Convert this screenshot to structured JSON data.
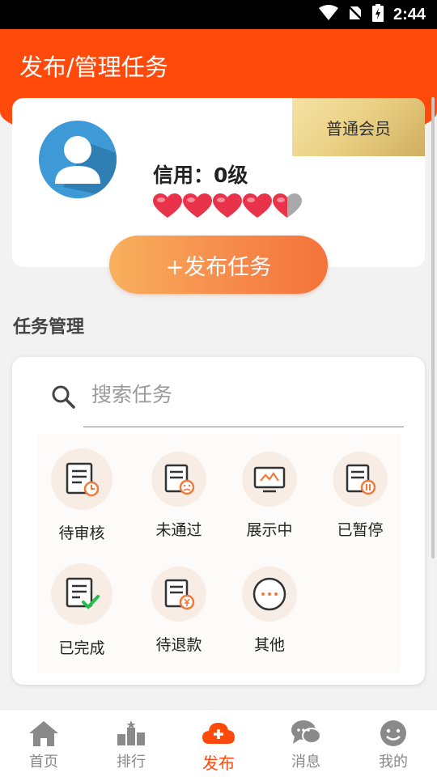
{
  "status_bar": {
    "time": "2:44"
  },
  "header": {
    "title": "发布/管理任务"
  },
  "profile": {
    "member_level": "普通会员",
    "credit_text": "信用：0级",
    "hearts_full": 4,
    "hearts_total": 5
  },
  "publish_button": {
    "label": "+发布任务"
  },
  "task_management": {
    "title": "任务管理",
    "search": {
      "placeholder": "搜索任务"
    },
    "items": [
      {
        "label": "待审核",
        "icon": "pending-review-icon"
      },
      {
        "label": "未通过",
        "icon": "rejected-icon"
      },
      {
        "label": "展示中",
        "icon": "displaying-icon"
      },
      {
        "label": "已暂停",
        "icon": "paused-icon"
      },
      {
        "label": "已完成",
        "icon": "completed-icon"
      },
      {
        "label": "待退款",
        "icon": "pending-refund-icon"
      },
      {
        "label": "其他",
        "icon": "more-icon"
      }
    ]
  },
  "bottom_nav": {
    "items": [
      {
        "label": "首页",
        "icon": "home-icon"
      },
      {
        "label": "排行",
        "icon": "ranking-icon"
      },
      {
        "label": "发布",
        "icon": "publish-icon",
        "active": true
      },
      {
        "label": "消息",
        "icon": "message-icon"
      },
      {
        "label": "我的",
        "icon": "profile-icon"
      }
    ]
  },
  "colors": {
    "primary": "#ff4a0b",
    "icon_accent": "#f07a3c",
    "member_gold": "#e9cf82",
    "heart_red": "#e8334a"
  }
}
